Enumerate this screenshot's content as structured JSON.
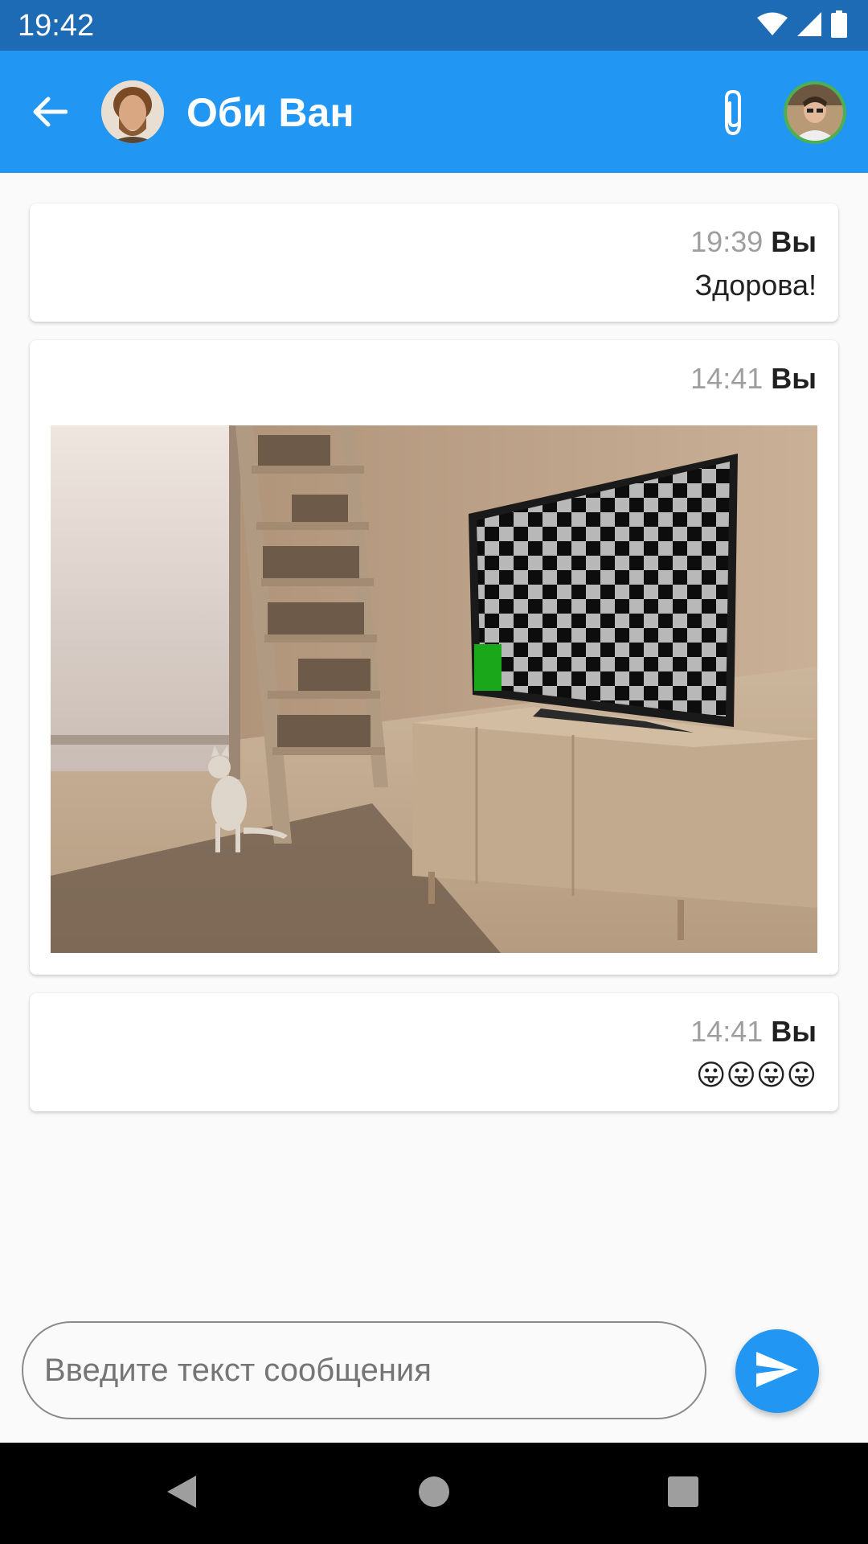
{
  "status_bar": {
    "time": "19:42",
    "icons": [
      "wifi-icon",
      "cellular-signal-icon",
      "battery-icon"
    ]
  },
  "app_bar": {
    "contact_name": "Оби Ван",
    "icons": [
      "back-arrow-icon",
      "paperclip-icon"
    ],
    "background_color": "#2196f3"
  },
  "messages": [
    {
      "time": "19:39",
      "author": "Вы",
      "text": "Здорова!"
    },
    {
      "time": "14:41",
      "author": "Вы",
      "image": "photo of a room with a TV showing a checkerboard pattern, bookshelf ladder and a cat"
    },
    {
      "time": "14:41",
      "author": "Вы",
      "text": "😛😛😛😛"
    }
  ],
  "composer": {
    "placeholder": "Введите текст сообщения",
    "value": "",
    "send_icon": "send-icon"
  },
  "nav_bar": {
    "icons": [
      "back-triangle-icon",
      "home-circle-icon",
      "recents-square-icon"
    ]
  }
}
